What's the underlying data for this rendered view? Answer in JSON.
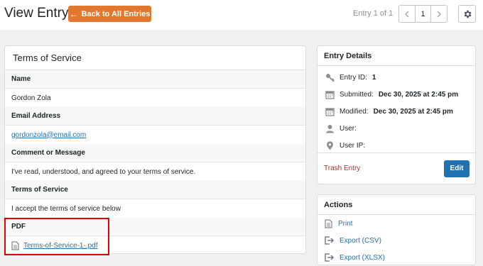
{
  "header": {
    "title": "View Entry",
    "back_label": "Back to All Entries",
    "entry_of": "Entry 1 of 1",
    "page_number": "1"
  },
  "form": {
    "title": "Terms of Service",
    "fields": [
      {
        "label": "Name",
        "value": "Gordon Zola"
      },
      {
        "label": "Email Address",
        "value": "gordonzola@email.com"
      },
      {
        "label": "Comment or Message",
        "value": "I've read, understood, and agreed to your terms of service."
      },
      {
        "label": "Terms of Service",
        "value": "I accept the terms of service below"
      },
      {
        "label": "PDF",
        "value": "Terms-of-Service-1-.pdf"
      }
    ]
  },
  "details": {
    "title": "Entry Details",
    "entry_id_label": "Entry ID:",
    "entry_id": "1",
    "submitted_label": "Submitted:",
    "submitted": "Dec 30, 2025 at 2:45 pm",
    "modified_label": "Modified:",
    "modified": "Dec 30, 2025 at 2:45 pm",
    "user_label": "User:",
    "user_ip_label": "User IP:",
    "trash_label": "Trash Entry",
    "edit_label": "Edit"
  },
  "actions": {
    "title": "Actions",
    "items": [
      {
        "label": "Print",
        "icon": "print-icon"
      },
      {
        "label": "Export (CSV)",
        "icon": "export-icon"
      },
      {
        "label": "Export (XLSX)",
        "icon": "export-icon"
      }
    ]
  },
  "colors": {
    "accent_orange": "#e27730",
    "link_blue": "#2271b1",
    "trash_red": "#b32d2e",
    "highlight_red": "#e30000"
  }
}
